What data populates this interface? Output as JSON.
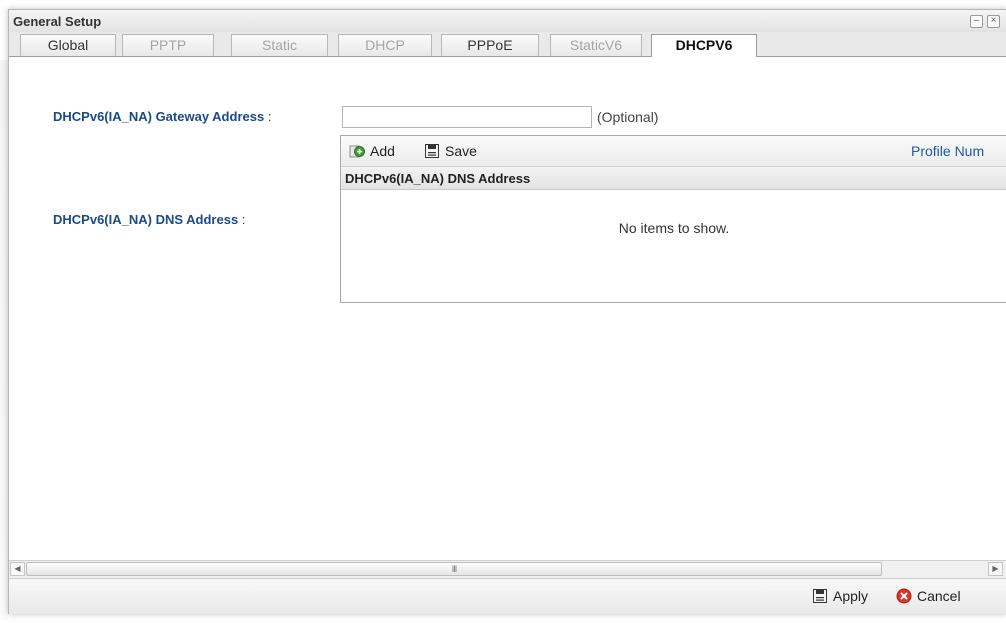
{
  "window": {
    "title": "General Setup",
    "minimize_glyph": "–",
    "close_glyph": "×"
  },
  "tabs": [
    {
      "label": "Global",
      "state": "enabled"
    },
    {
      "label": "PPTP",
      "state": "disabled"
    },
    {
      "label": "Static",
      "state": "disabled"
    },
    {
      "label": "DHCP",
      "state": "disabled"
    },
    {
      "label": "PPPoE",
      "state": "enabled"
    },
    {
      "label": "StaticV6",
      "state": "disabled"
    },
    {
      "label": "DHCPV6",
      "state": "active"
    }
  ],
  "form": {
    "gateway_label": "DHCPv6(IA_NA) Gateway Address",
    "gateway_value": "",
    "gateway_hint": "(Optional)",
    "dns_label": "DHCPv6(IA_NA) DNS Address",
    "colon": ":"
  },
  "grid": {
    "add_label": "Add",
    "save_label": "Save",
    "profile_num_label": "Profile Num",
    "column_header": "DHCPv6(IA_NA) DNS Address",
    "empty_text": "No items to show."
  },
  "scrollbar": {
    "left_glyph": "◀",
    "right_glyph": "▶",
    "thumb_grip": "III"
  },
  "footer": {
    "apply_label": "Apply",
    "cancel_label": "Cancel"
  },
  "icons": {
    "add": "add-icon",
    "save": "save-icon",
    "apply": "apply-icon",
    "cancel": "cancel-icon"
  },
  "colors": {
    "label_blue": "#1a4a8a",
    "link_blue": "#1d5aa8",
    "add_green": "#3a9b2c",
    "cancel_red": "#d9352a"
  }
}
